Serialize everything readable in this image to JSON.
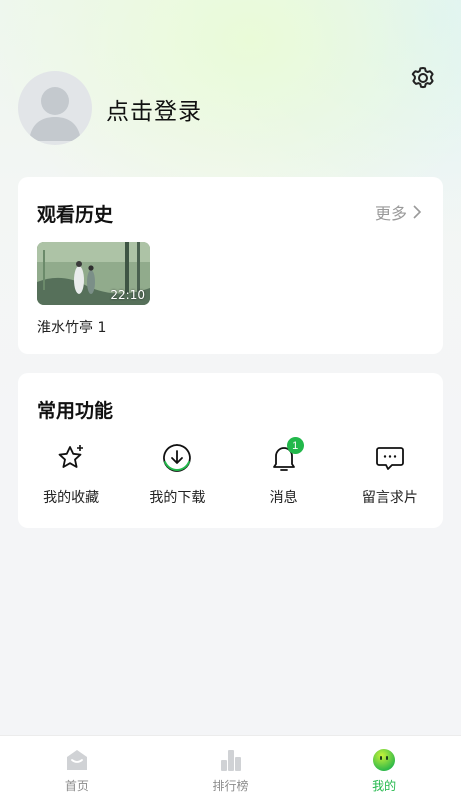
{
  "header": {
    "login_text": "点击登录"
  },
  "history": {
    "title": "观看历史",
    "more_label": "更多",
    "items": [
      {
        "title": "淮水竹亭 1",
        "duration": "22:10"
      }
    ]
  },
  "functions": {
    "title": "常用功能",
    "items": [
      {
        "label": "我的收藏",
        "icon": "star-icon"
      },
      {
        "label": "我的下载",
        "icon": "download-icon"
      },
      {
        "label": "消息",
        "icon": "bell-icon",
        "badge": "1"
      },
      {
        "label": "留言求片",
        "icon": "message-icon"
      }
    ]
  },
  "tabbar": {
    "items": [
      {
        "label": "首页",
        "icon": "home-icon"
      },
      {
        "label": "排行榜",
        "icon": "ranking-icon"
      },
      {
        "label": "我的",
        "icon": "profile-icon"
      }
    ]
  },
  "colors": {
    "accent": "#22b84b",
    "muted": "#9a9a9a",
    "background": "#f4f5f7"
  }
}
